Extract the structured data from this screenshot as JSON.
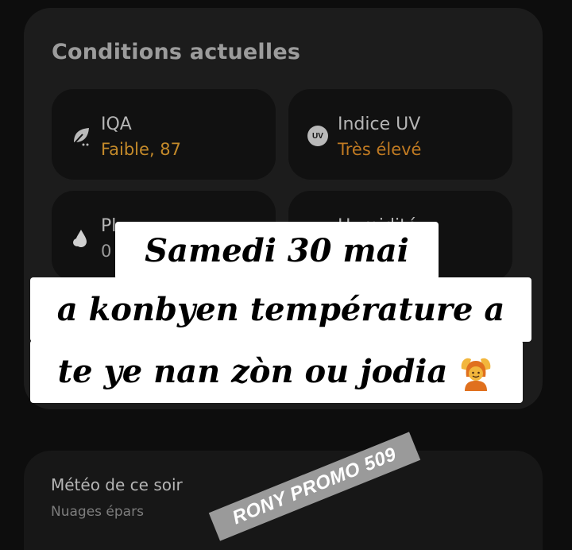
{
  "conditions": {
    "title": "Conditions actuelles",
    "tiles": [
      {
        "icon": "leaf-icon",
        "label": "IQA",
        "value": "Faible, 87",
        "value_color": "#c48a2a"
      },
      {
        "icon": "uv-icon",
        "icon_text": "UV",
        "label": "Indice UV",
        "value": "Très élevé",
        "value_color": "#c07a22"
      },
      {
        "icon": "rain-drop-icon",
        "label": "Pl",
        "value": "0"
      },
      {
        "icon": "humidity-icon",
        "label": "Humidité",
        "value": ""
      }
    ]
  },
  "tonight": {
    "title": "Météo de ce soir",
    "subtitle": "Nuages épars"
  },
  "caption": {
    "line1": "Samedi 30 mai",
    "line2": "a konbyen température a",
    "line3": "te ye nan zòn ou jodia",
    "emoji": "person-gesturing-ok-emoji"
  },
  "watermark": {
    "text": "RONY PROMO 509"
  }
}
